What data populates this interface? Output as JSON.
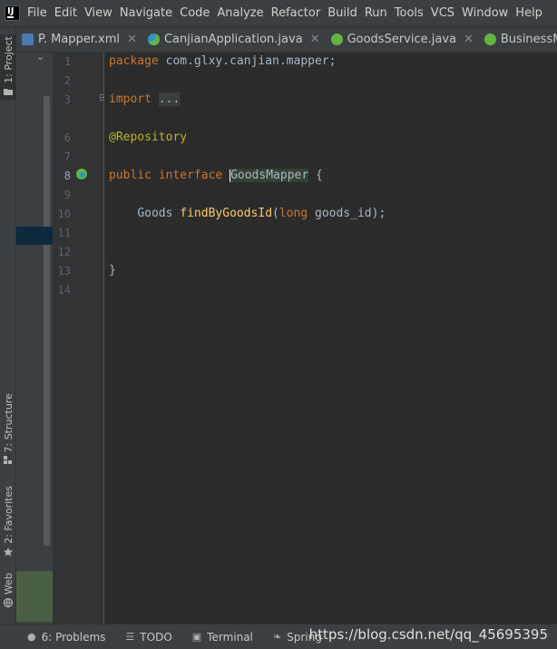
{
  "menu": {
    "items": [
      "File",
      "Edit",
      "View",
      "Navigate",
      "Code",
      "Analyze",
      "Refactor",
      "Build",
      "Run",
      "Tools",
      "VCS",
      "Window",
      "Help"
    ]
  },
  "tabs": [
    {
      "label": "P. Mapper.xml",
      "icon": "xml-file-icon",
      "active": false
    },
    {
      "label": "CanjianApplication.java",
      "icon": "spring-class-icon",
      "active": false
    },
    {
      "label": "GoodsService.java",
      "icon": "interface-icon",
      "active": false
    },
    {
      "label": "BusinessMapper",
      "icon": "interface-icon",
      "active": false
    }
  ],
  "left_tools": {
    "project": "1: Project",
    "structure": "7: Structure",
    "favorites": "2: Favorites",
    "web": "Web"
  },
  "gutter": {
    "line_numbers": [
      "1",
      "2",
      "3",
      "6",
      "7",
      "8",
      "9",
      "10",
      "11",
      "12",
      "13",
      "14"
    ],
    "current_line": "8"
  },
  "code": {
    "line1_kw": "package",
    "line1_rest": " com.glxy.canjian.mapper;",
    "line3_kw": "import",
    "line3_fold": "...",
    "line6_ann": "@Repository",
    "line8_kw1": "public",
    "line8_kw2": "interface",
    "line8_name": "GoodsMapper",
    "line8_brace": " {",
    "line10_type": "Goods",
    "line10_method": "findByGoodsId",
    "line10_paren": "(",
    "line10_ptype": "long",
    "line10_param": " goods_id);",
    "line13": "}"
  },
  "status": {
    "problems": "6: Problems",
    "todo": "TODO",
    "terminal": "Terminal",
    "spring": "Spring",
    "watermark": "https://blog.csdn.net/qq_45695395"
  },
  "colors": {
    "background": "#2b2b2b",
    "keyword": "#cc7832",
    "annotation": "#bbb529",
    "method": "#ffc66d",
    "text": "#a9b7c6"
  }
}
